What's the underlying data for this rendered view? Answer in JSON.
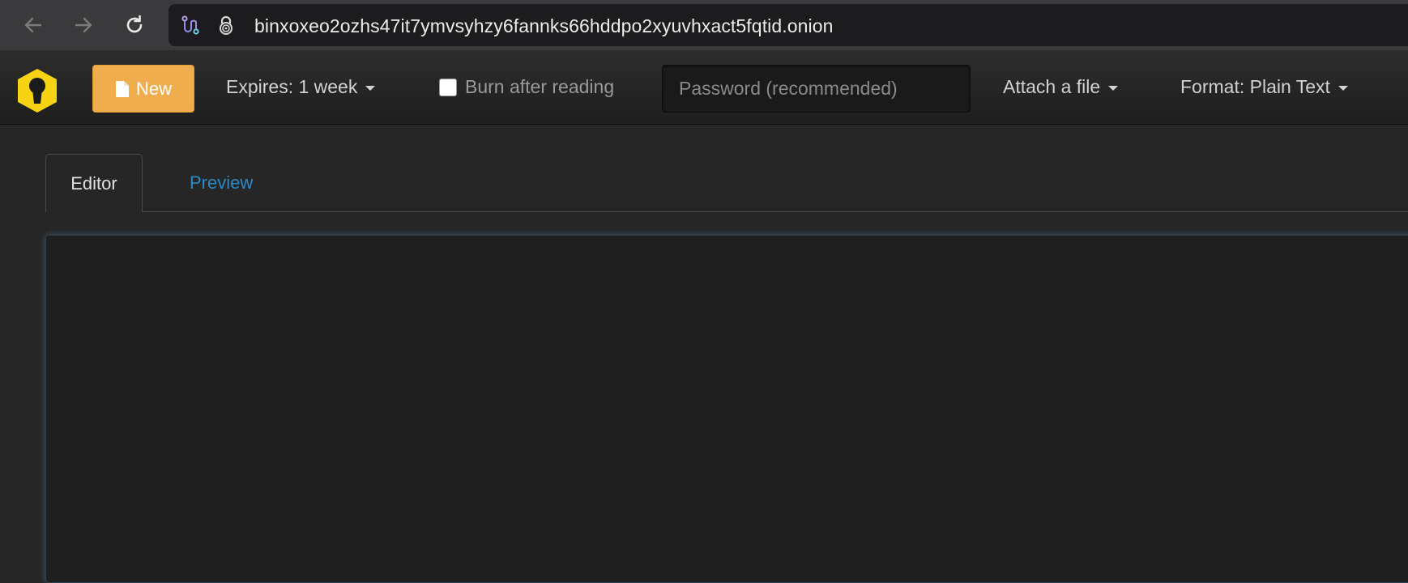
{
  "browser": {
    "url": "binxoxeo2ozhs47it7ymvsyhzy6fannks66hddpo2xyuvhxact5fqtid.onion"
  },
  "toolbar": {
    "new_label": "New",
    "expires_label": "Expires: 1 week",
    "burn_label": "Burn after reading",
    "password_placeholder": "Password (recommended)",
    "attach_label": "Attach a file",
    "format_label": "Format: Plain Text"
  },
  "tabs": {
    "editor": "Editor",
    "preview": "Preview"
  },
  "colors": {
    "accent": "#f0ad4e",
    "link": "#2a8ac8",
    "logo": "#f6d313"
  },
  "icons": [
    "back-arrow-icon",
    "forward-arrow-icon",
    "reload-icon",
    "tor-circuit-icon",
    "onion-lock-icon",
    "keyhole-logo-icon",
    "file-icon",
    "caret-down-icon"
  ]
}
